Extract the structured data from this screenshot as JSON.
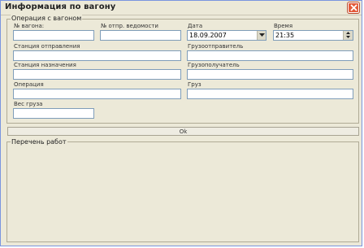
{
  "window": {
    "title": "Информация по вагону"
  },
  "group_operation": {
    "legend": "Операция с вагоном",
    "fields": {
      "wagon_number": {
        "label": "№ вагона:",
        "value": ""
      },
      "statement_number": {
        "label": "№ отпр. ведомости",
        "value": ""
      },
      "date": {
        "label": "Дата",
        "value": "18.09.2007"
      },
      "time": {
        "label": "Время",
        "value": "21:35"
      },
      "sender_station": {
        "label": "Станция отправления",
        "value": ""
      },
      "cargo_sender": {
        "label": "Грузоотправитель",
        "value": ""
      },
      "destination_station": {
        "label": "Станция назначения",
        "value": ""
      },
      "cargo_receiver": {
        "label": "Грузополучатель",
        "value": ""
      },
      "operation": {
        "label": "Операция",
        "value": ""
      },
      "cargo": {
        "label": "Груз",
        "value": ""
      },
      "weight": {
        "label": "Вес груза",
        "value": ""
      }
    }
  },
  "ok_button": {
    "label": "Ok"
  },
  "group_works": {
    "legend": "Перечень работ"
  },
  "icons": {
    "close": "close-icon",
    "dropdown": "chevron-down-icon",
    "spin_up": "spin-up-icon",
    "spin_down": "spin-down-icon"
  }
}
